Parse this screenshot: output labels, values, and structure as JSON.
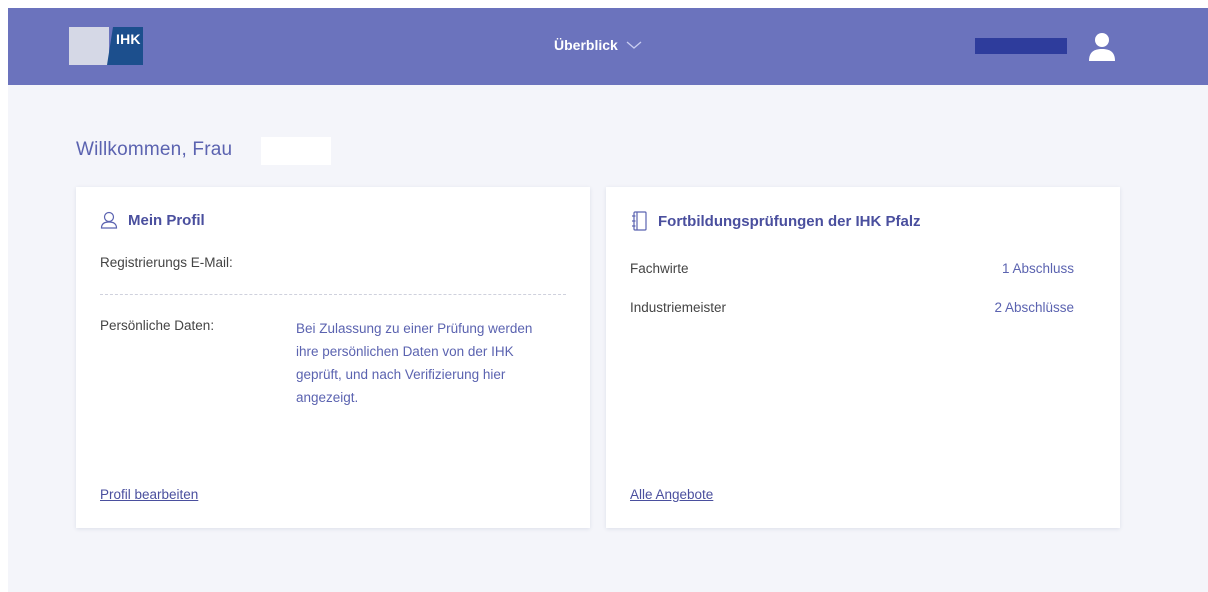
{
  "header": {
    "logo_text": "IHK",
    "nav_label": "Überblick",
    "colors": {
      "bar": "#6b73bd",
      "accent": "#4a4f9e"
    }
  },
  "welcome": {
    "text": "Willkommen, Frau"
  },
  "profile_card": {
    "title": "Mein Profil",
    "email_label": "Registrierungs E-Mail:",
    "personal_label": "Persönliche Daten:",
    "personal_info": "Bei Zulassung zu einer Prüfung werden ihre persönlichen Daten von der IHK geprüft, und nach Verifizierung hier angezeigt.",
    "edit_link": "Profil bearbeiten"
  },
  "exams_card": {
    "title": "Fortbildungsprüfungen der IHK Pfalz",
    "rows": [
      {
        "label": "Fachwirte",
        "value": "1 Abschluss"
      },
      {
        "label": "Industriemeister",
        "value": "2 Abschlüsse"
      }
    ],
    "all_link": "Alle Angebote"
  }
}
